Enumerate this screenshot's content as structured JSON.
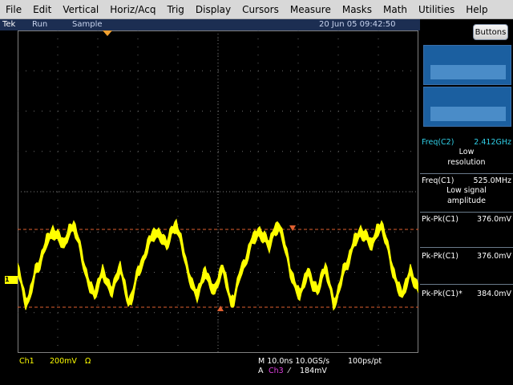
{
  "menu": [
    "File",
    "Edit",
    "Vertical",
    "Horiz/Acq",
    "Trig",
    "Display",
    "Cursors",
    "Measure",
    "Masks",
    "Math",
    "Utilities",
    "Help"
  ],
  "status": {
    "brand": "Tek",
    "run_state": "Run",
    "mode": "Sample",
    "datetime": "20 Jun 05 09:42:50"
  },
  "buttons_label": "Buttons",
  "measurements": [
    {
      "label": "Freq(C2)",
      "value": "2.412GHz",
      "note": [
        "Low",
        "resolution"
      ],
      "label_color": "#30d0e8"
    },
    {
      "label": "Freq(C1)",
      "value": "525.0MHz",
      "note": [
        "Low signal",
        "amplitude"
      ],
      "label_color": "#ffffff"
    },
    {
      "label": "Pk-Pk(C1)",
      "value": "376.0mV",
      "note": [],
      "label_color": "#ffffff"
    },
    {
      "label": "Pk-Pk(C1)",
      "value": "376.0mV",
      "note": [],
      "label_color": "#ffffff"
    },
    {
      "label": "Pk-Pk(C1)*",
      "value": "384.0mV",
      "note": [],
      "label_color": "#ffffff"
    }
  ],
  "bottom": {
    "channel": "Ch1",
    "volts_div": "200mV",
    "ohm": "Ω",
    "timebase": "M 10.0ns 10.0GS/s",
    "pts": "100ps/pt",
    "trig_prefix": "A",
    "trig_source": "Ch3",
    "trig_slope": "⁄",
    "trig_level": "184mV"
  },
  "ch1_marker": "1",
  "colors": {
    "trace": "#ffff00",
    "cursor": "#e06030",
    "statusbar": "#1c2e52",
    "ch3": "#e040e0"
  }
}
